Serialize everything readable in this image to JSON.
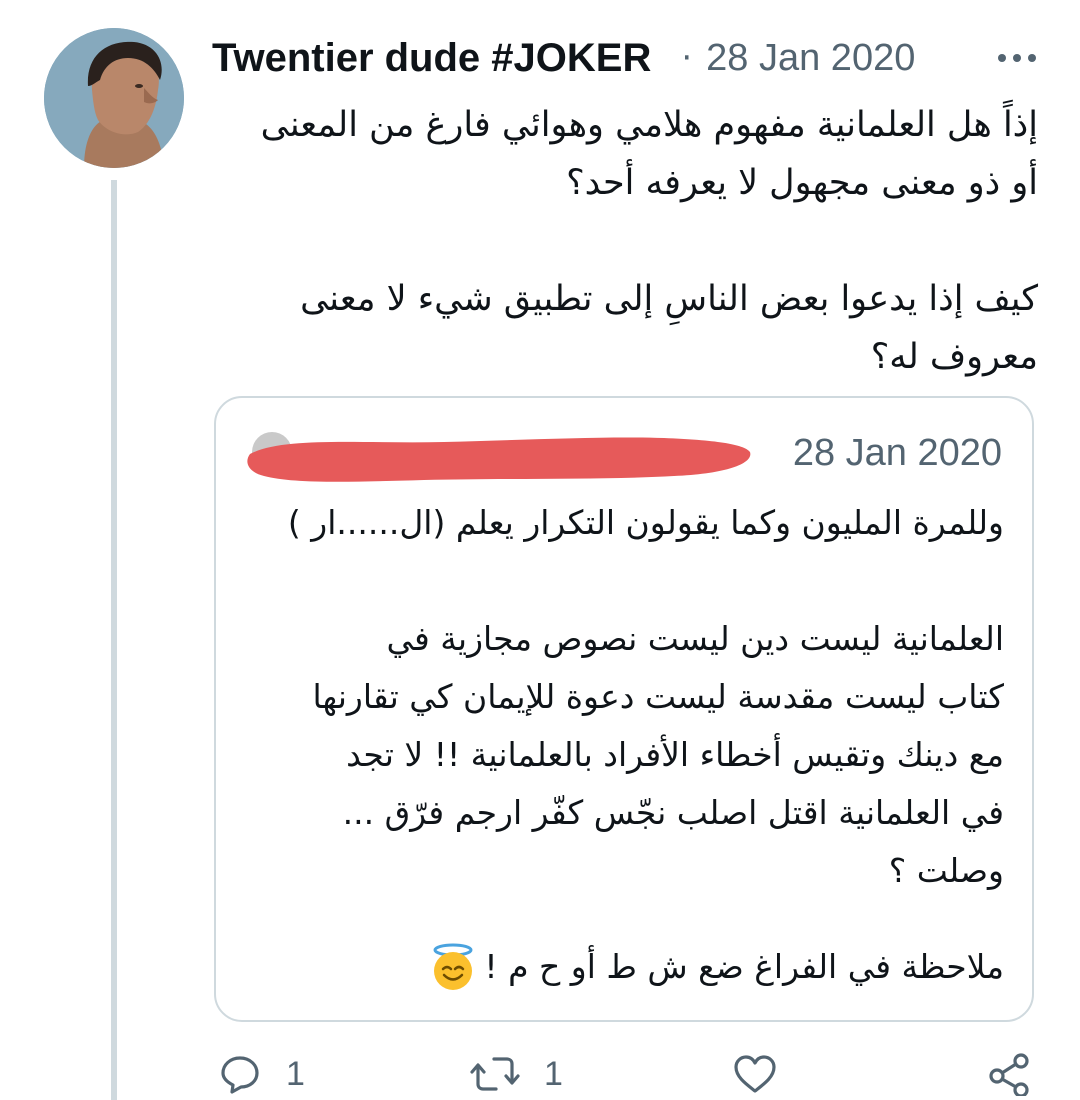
{
  "tweet": {
    "author_name": "Twentier dude #JOKER",
    "separator": "·",
    "date": "28 Jan 2020",
    "text": "إذاً هل العلمانية مفهوم هلامي وهوائي فارغ من المعنى\nأو ذو معنى مجهول لا يعرفه أحد؟\n\nكيف إذا يدعوا بعض الناسِ إلى تطبيق شيء لا معنى\nمعروف له؟"
  },
  "quote": {
    "date": "28 Jan 2020",
    "text": "وللمرة المليون وكما يقولون التكرار يعلم (ال......ار )\n\nالعلمانية ليست دين ليست نصوص مجازية في\nكتاب ليست مقدسة ليست دعوة للإيمان كي تقارنها\nمع دينك وتقيس أخطاء الأفراد بالعلمانية !! لا تجد\nفي العلمانية اقتل اصلب نجّس كفّر ارجم فرّق ...\nوصلت ؟",
    "note": "ملاحظة في الفراغ ضع ش ط أو ح م !",
    "note_emoji": "smiling-face-with-halo-icon"
  },
  "actions": {
    "reply_count": "1",
    "retweet_count": "1"
  },
  "colors": {
    "text": "#0f1419",
    "secondary": "#536471",
    "border": "#cfd9de",
    "redaction": "#e65a5a"
  }
}
